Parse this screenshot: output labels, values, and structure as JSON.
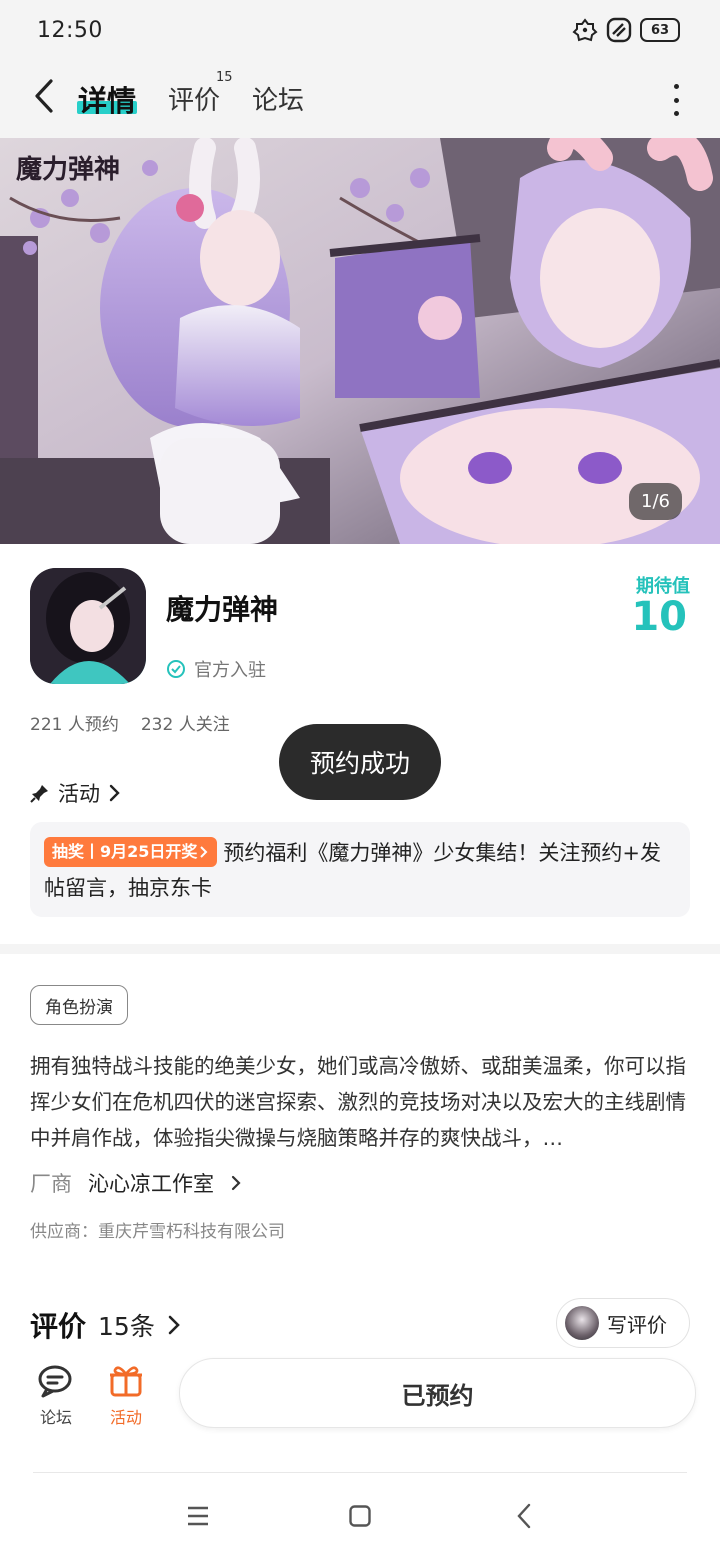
{
  "status_bar": {
    "time": "12:50",
    "battery": "63"
  },
  "nav": {
    "tabs": [
      {
        "label": "详情",
        "active": true
      },
      {
        "label": "评价",
        "badge": "15"
      },
      {
        "label": "论坛"
      }
    ]
  },
  "banner": {
    "logo_text": "魔力弹神",
    "counter": "1/6"
  },
  "game": {
    "title": "魔力弹神",
    "official_label": "官方入驻",
    "expect_label": "期待值",
    "expect_value": "10",
    "reservations": "221 人预约",
    "followers": "232 人关注"
  },
  "toast": "预约成功",
  "activity": {
    "heading": "活动",
    "badge": "抽奖丨9月25日开奖",
    "text": "预约福利《魔力弹神》少女集结！关注预约+发帖留言，抽京东卡"
  },
  "tag": "角色扮演",
  "description": "拥有独特战斗技能的绝美少女，她们或高冷傲娇、或甜美温柔，你可以指挥少女们在危机四伏的迷宫探索、激烈的竞技场对决以及宏大的主线剧情中并肩作战，体验指尖微操与烧脑策略并存的爽快战斗，…",
  "vendor": {
    "label": "厂商",
    "name": "沁心凉工作室"
  },
  "supplier": "供应商：重庆芹雪朽科技有限公司",
  "reviews": {
    "title": "评价",
    "count": "15条",
    "write_label": "写评价"
  },
  "bottom_bar": {
    "forum_label": "论坛",
    "activity_label": "活动",
    "reserved_label": "已预约"
  },
  "colors": {
    "accent": "#28cfc9",
    "activity": "#f26b28",
    "badge": "#ff7a3d"
  }
}
